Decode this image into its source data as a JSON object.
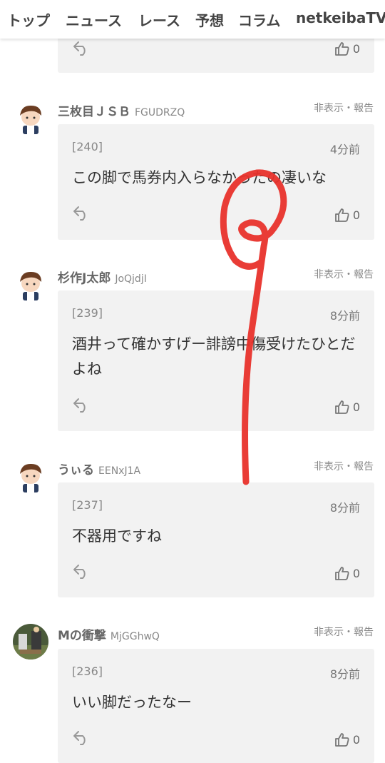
{
  "nav": {
    "items": [
      "トップ",
      "ニュース",
      "レース",
      "予想",
      "コラム",
      "netkeibaTV"
    ]
  },
  "top_card": {
    "likes": "0"
  },
  "comments": [
    {
      "user": "三枚目ＪＳＢ",
      "uid": "FGUDRZQ",
      "actions": "非表示・報告",
      "num": "[240]",
      "time": "4分前",
      "text": "この脚で馬券内入らなかったの凄いな",
      "likes": "0"
    },
    {
      "user": "杉作J太郎",
      "uid": "JoQjdjI",
      "actions": "非表示・報告",
      "num": "[239]",
      "time": "8分前",
      "text": "酒井って確かすげー誹謗中傷受けたひとだよね",
      "likes": "0"
    },
    {
      "user": "うぃる",
      "uid": "EENxJ1A",
      "actions": "非表示・報告",
      "num": "[237]",
      "time": "8分前",
      "text": "不器用ですね",
      "likes": "0"
    },
    {
      "user": "Mの衝撃",
      "uid": "MjGGhwQ",
      "actions": "非表示・報告",
      "num": "[236]",
      "time": "8分前",
      "text": "いい脚だったなー",
      "likes": "0"
    }
  ],
  "colors": {
    "card_bg": "#f2f2f2",
    "scribble": "#e8322b"
  },
  "icons": [
    "reply-icon",
    "thumbs-up-icon"
  ]
}
